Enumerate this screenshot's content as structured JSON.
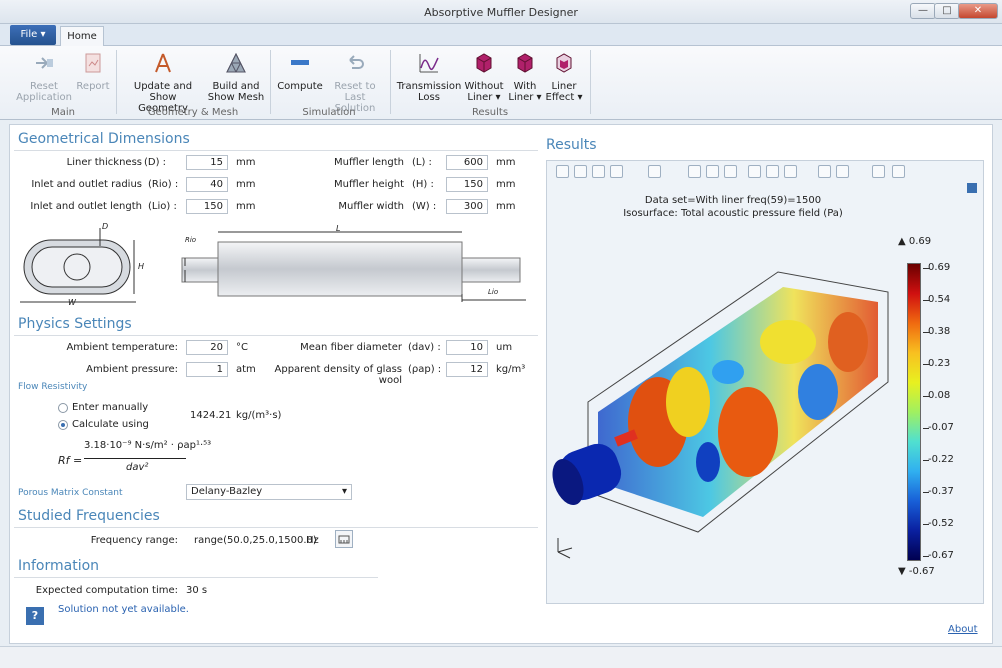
{
  "window": {
    "title": "Absorptive Muffler Designer",
    "min": "—",
    "max": "□",
    "close": "✕"
  },
  "tabs": {
    "file": "File ▾",
    "home": "Home"
  },
  "ribbon": {
    "reset_app": "Reset\nApplication",
    "report": "Report",
    "main_group": "Main",
    "update_geom": "Update and Show\nGeometry",
    "build_mesh": "Build and\nShow Mesh",
    "geom_group": "Geometry & Mesh",
    "compute": "Compute",
    "reset_last": "Reset to Last\nSolution",
    "sim_group": "Simulation",
    "trans_loss": "Transmission\nLoss",
    "without_liner": "Without\nLiner ▾",
    "with_liner": "With\nLiner ▾",
    "liner_effect": "Liner\nEffect ▾",
    "results_group": "Results"
  },
  "geom": {
    "title": "Geometrical Dimensions",
    "liner_thickness": {
      "label": "Liner thickness",
      "sym": "(D) :",
      "value": "15",
      "unit": "mm"
    },
    "inlet_radius": {
      "label": "Inlet and outlet radius",
      "sym": "(Rio) :",
      "value": "40",
      "unit": "mm"
    },
    "inlet_length": {
      "label": "Inlet and outlet length",
      "sym": "(Lio) :",
      "value": "150",
      "unit": "mm"
    },
    "muffler_length": {
      "label": "Muffler length",
      "sym": "(L) :",
      "value": "600",
      "unit": "mm"
    },
    "muffler_height": {
      "label": "Muffler height",
      "sym": "(H) :",
      "value": "150",
      "unit": "mm"
    },
    "muffler_width": {
      "label": "Muffler width",
      "sym": "(W) :",
      "value": "300",
      "unit": "mm"
    },
    "d_label": "D",
    "h_label": "H",
    "w_label": "W",
    "rio_label": "Rio",
    "l_label": "L",
    "lio_label": "Lio"
  },
  "physics": {
    "title": "Physics Settings",
    "ambient_temp": {
      "label": "Ambient temperature:",
      "value": "20",
      "unit": "°C"
    },
    "ambient_press": {
      "label": "Ambient pressure:",
      "value": "1",
      "unit": "atm"
    },
    "fiber_diam": {
      "label": "Mean fiber diameter",
      "sym": "(dav) :",
      "value": "10",
      "unit": "um"
    },
    "density": {
      "label": "Apparent density of glass wool",
      "sym": "(ρap) :",
      "value": "12",
      "unit": "kg/m³"
    },
    "flow_res": "Flow Resistivity",
    "enter_manually": "Enter manually",
    "calc_using": "Calculate using",
    "rf_value": "1424.21",
    "rf_unit": "kg/(m³·s)",
    "formula_lhs": "Rf =",
    "formula_num": "3.18·10⁻⁹ N·s/m² · ρap¹·⁵³",
    "formula_den": "dav²",
    "porous_label": "Porous Matrix Constant",
    "porous_value": "Delany-Bazley"
  },
  "freq": {
    "title": "Studied Frequencies",
    "label": "Frequency range:",
    "value": "range(50.0,25.0,1500.0)",
    "unit": "Hz"
  },
  "info": {
    "title": "Information",
    "time_label": "Expected computation time:",
    "time_value": "30 s",
    "status": "Solution not yet available.",
    "help": "?"
  },
  "results": {
    "title": "Results",
    "line1": "Data set=With liner freq(59)=1500",
    "line2": "Isosurface: Total acoustic pressure field (Pa)",
    "max": "▲ 0.69",
    "min": "▼ -0.67",
    "ticks": [
      "0.69",
      "0.54",
      "0.38",
      "0.23",
      "0.08",
      "-0.07",
      "-0.22",
      "-0.37",
      "-0.52",
      "-0.67"
    ]
  },
  "about": "About"
}
